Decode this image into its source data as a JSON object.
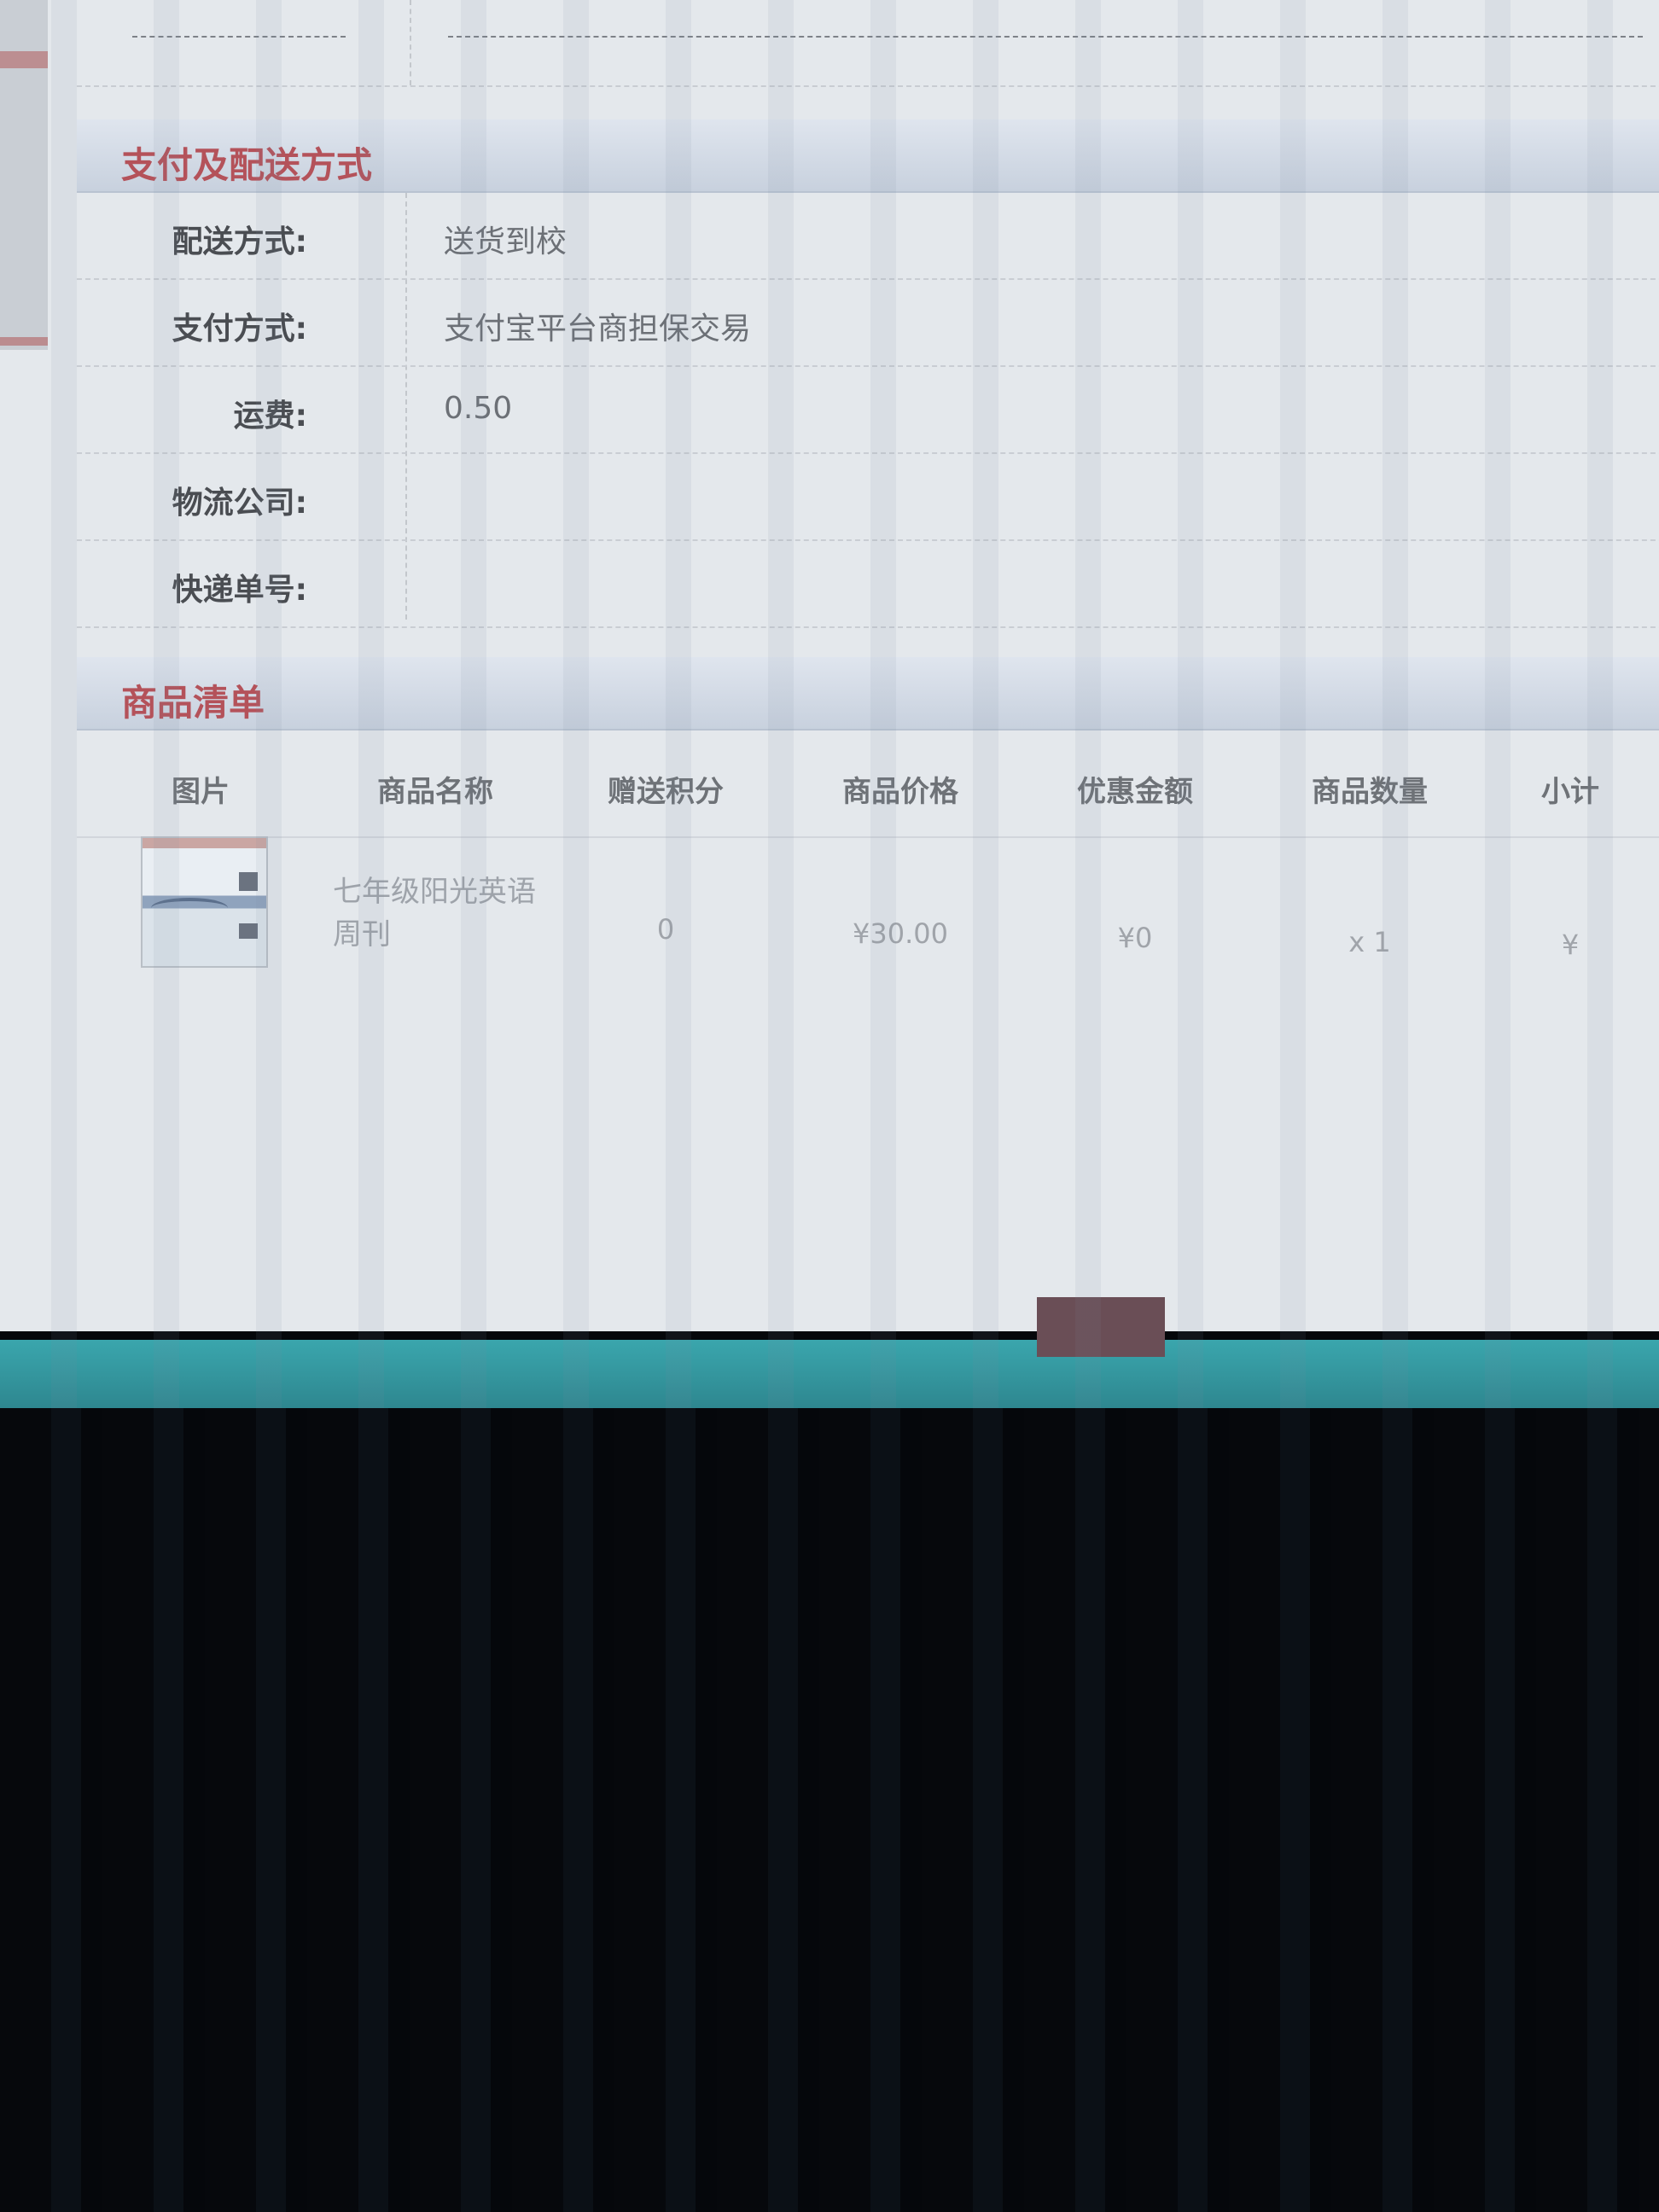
{
  "payment_section": {
    "title": "支付及配送方式",
    "rows": [
      {
        "label": "配送方式:",
        "value": "送货到校"
      },
      {
        "label": "支付方式:",
        "value": "支付宝平台商担保交易"
      },
      {
        "label": "运费:",
        "value": "0.50"
      },
      {
        "label": "物流公司:",
        "value": ""
      },
      {
        "label": "快递单号:",
        "value": ""
      }
    ]
  },
  "goods_section": {
    "title": "商品清单",
    "columns": [
      "图片",
      "商品名称",
      "赠送积分",
      "商品价格",
      "优惠金额",
      "商品数量",
      "小计"
    ],
    "items": [
      {
        "name": "七年级阳光英语周刊",
        "points": "0",
        "price": "¥30.00",
        "discount": "¥0",
        "quantity": "x 1",
        "subtotal": "¥"
      }
    ]
  }
}
